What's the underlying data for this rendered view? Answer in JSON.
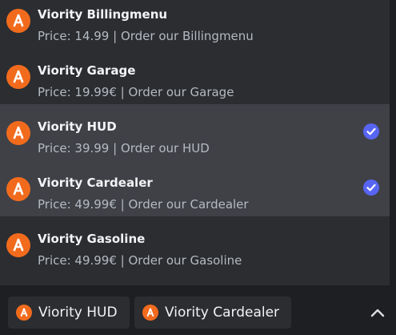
{
  "colors": {
    "logo_orange": "#f26b1d",
    "check_blurple": "#5865f2",
    "selected_row_bg": "#3f4147"
  },
  "options": [
    {
      "name": "Viority Billingmenu",
      "description": "Price: 14.99 | Order our Billingmenu",
      "selected": false,
      "icon": "viority-logo-icon"
    },
    {
      "name": "Viority Garage",
      "description": "Price: 19.99€ | Order our Garage",
      "selected": false,
      "icon": "viority-logo-icon"
    },
    {
      "name": "Viority HUD",
      "description": "Price: 39.99 | Order our HUD",
      "selected": true,
      "icon": "viority-logo-icon"
    },
    {
      "name": "Viority Cardealer",
      "description": "Price: 49.99€ | Order our Cardealer",
      "selected": true,
      "icon": "viority-logo-icon"
    },
    {
      "name": "Viority Gasoline",
      "description": "Price: 49.99€ | Order our Gasoline",
      "selected": false,
      "icon": "viority-logo-icon"
    }
  ],
  "selected_chips": [
    {
      "label": "Viority HUD"
    },
    {
      "label": "Viority Cardealer"
    }
  ],
  "collapse_icon": "chevron-up-icon"
}
